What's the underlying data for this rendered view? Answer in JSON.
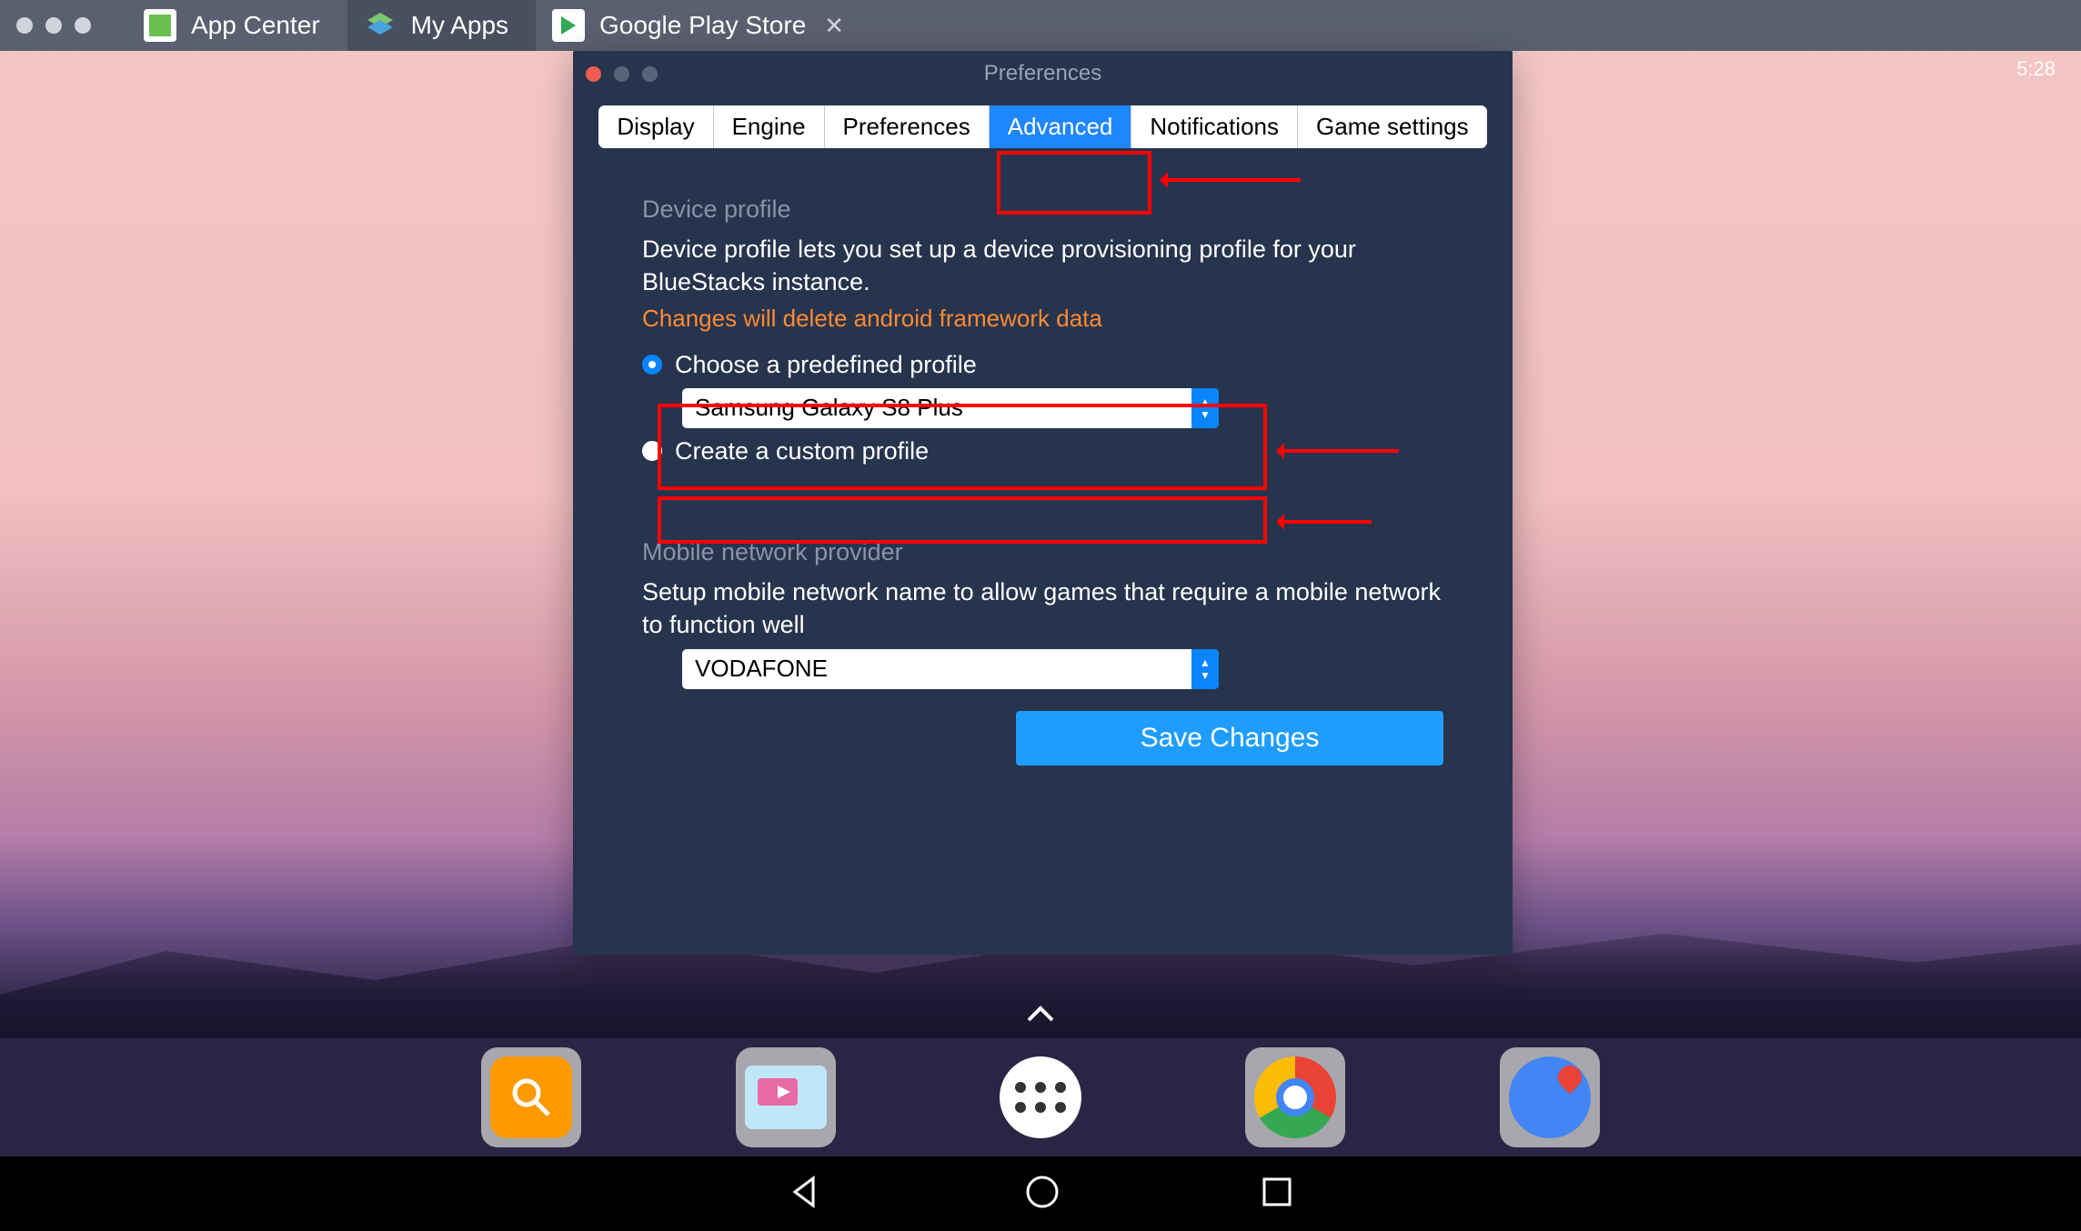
{
  "window": {
    "tabs": [
      {
        "label": "App Center",
        "icon": "appcenter"
      },
      {
        "label": "My Apps",
        "icon": "myapps",
        "active": true
      },
      {
        "label": "Google Play Store",
        "icon": "play",
        "closeable": true
      }
    ]
  },
  "status": {
    "time": "5:28"
  },
  "prefs": {
    "title": "Preferences",
    "tabs": [
      "Display",
      "Engine",
      "Preferences",
      "Advanced",
      "Notifications",
      "Game settings"
    ],
    "active_tab": "Advanced",
    "device_profile": {
      "heading": "Device profile",
      "description": "Device profile lets you set up a device provisioning profile for your BlueStacks instance.",
      "warning": "Changes will delete android framework data",
      "predefined_label": "Choose a predefined profile",
      "predefined_value": "Samsung Galaxy S8 Plus",
      "custom_label": "Create a custom profile",
      "selected": "predefined"
    },
    "network": {
      "heading": "Mobile network provider",
      "description": "Setup mobile network name to allow games that require a mobile network to function well",
      "value": "VODAFONE"
    },
    "save_label": "Save Changes"
  },
  "dock": {
    "apps": [
      "search",
      "media",
      "all-apps",
      "chrome",
      "maps"
    ]
  }
}
